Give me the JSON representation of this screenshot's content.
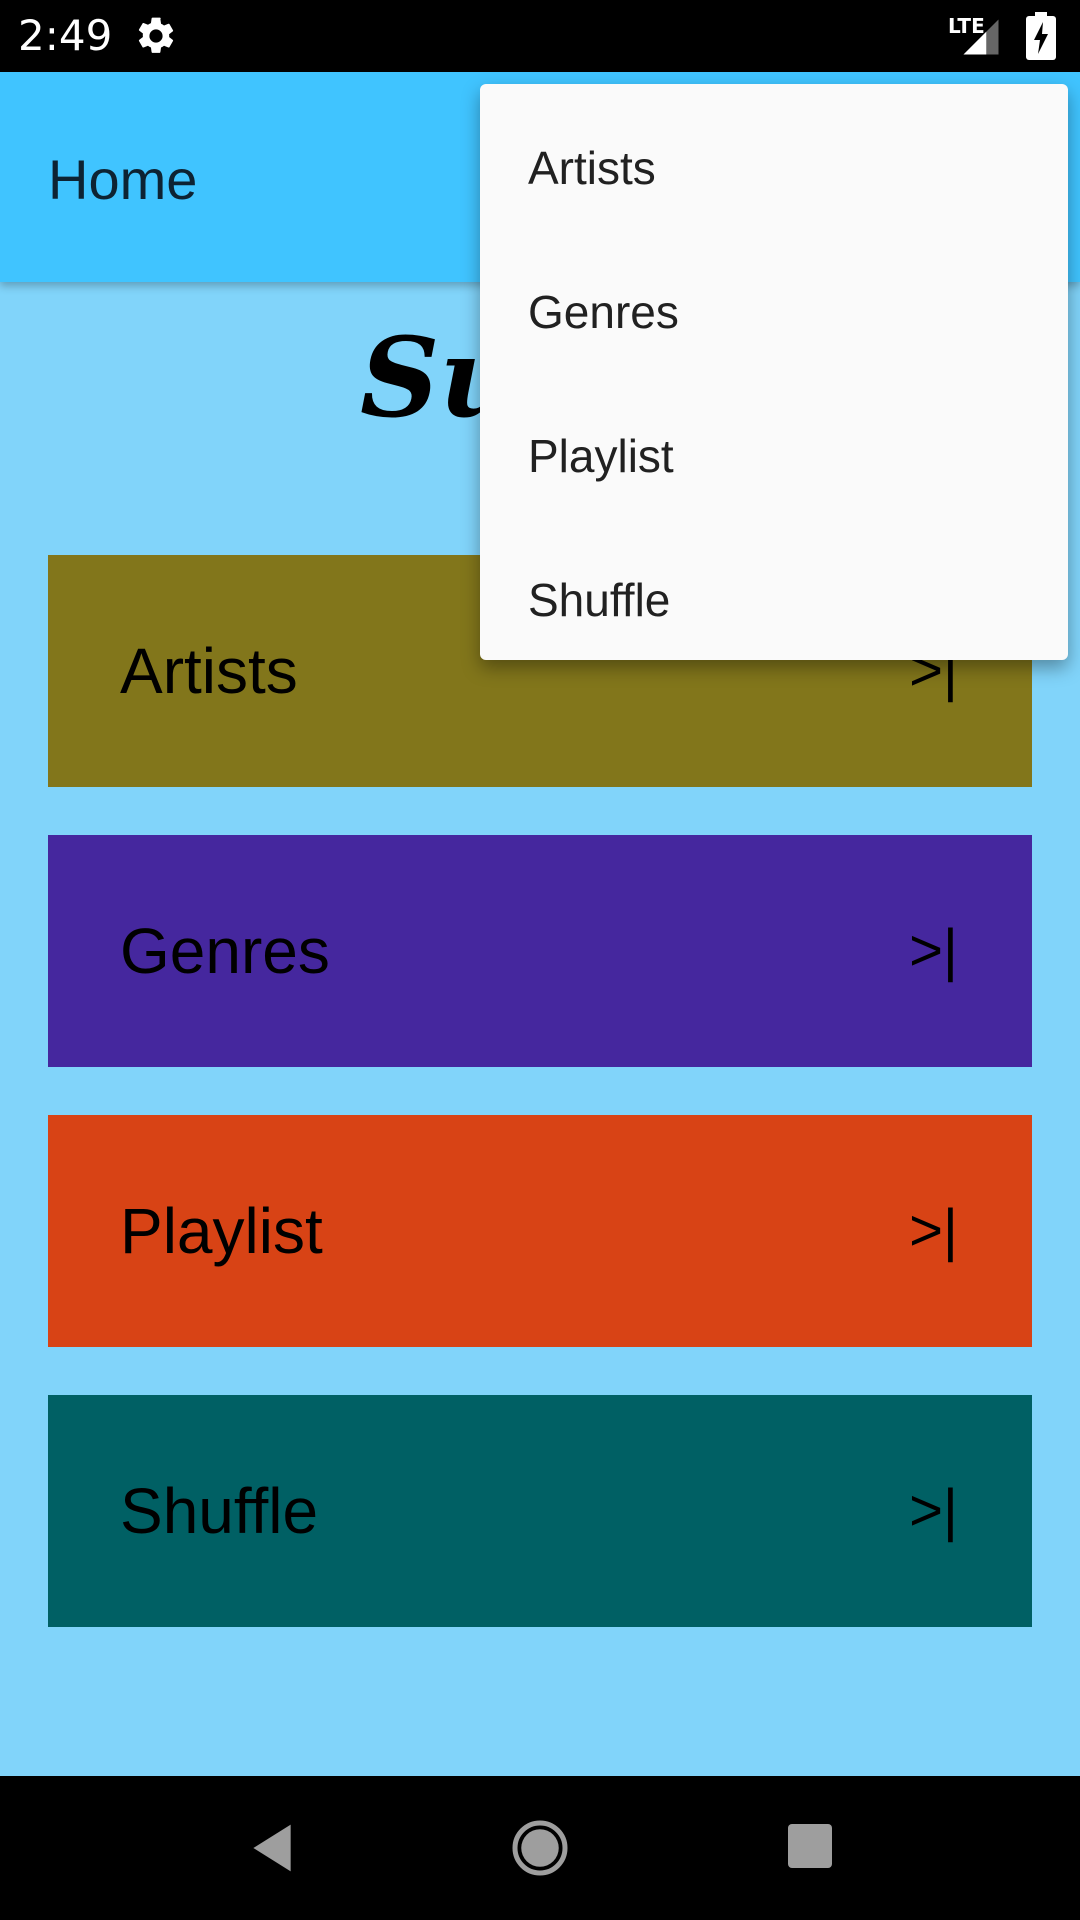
{
  "status_bar": {
    "time": "2:49",
    "network_label": "LTE",
    "icons": [
      "gear-icon",
      "signal-icon",
      "battery-charging-icon"
    ]
  },
  "app_bar": {
    "title": "Home"
  },
  "headline": {
    "visible_text": "Su"
  },
  "tiles": [
    {
      "label": "Artists",
      "arrow": ">|",
      "color": "#82761b"
    },
    {
      "label": "Genres",
      "arrow": ">|",
      "color": "#45279e"
    },
    {
      "label": "Playlist",
      "arrow": ">|",
      "color": "#d84315"
    },
    {
      "label": "Shuffle",
      "arrow": ">|",
      "color": "#006064"
    }
  ],
  "menu": {
    "items": [
      "Artists",
      "Genres",
      "Playlist",
      "Shuffle"
    ]
  },
  "nav_bar": {
    "icons": [
      "back-icon",
      "home-icon",
      "recents-icon"
    ]
  },
  "colors": {
    "background": "#81d4fa",
    "app_bar": "#40c4ff",
    "menu_background": "#fafafa"
  }
}
